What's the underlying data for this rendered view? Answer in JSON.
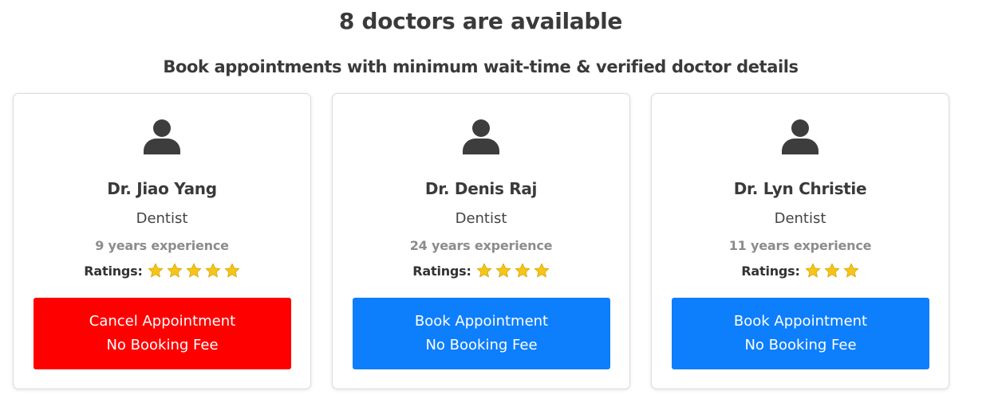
{
  "header": {
    "title": "8 doctors are available",
    "subtitle": "Book appointments with minimum wait-time & verified doctor details"
  },
  "colors": {
    "cancel_button": "#ff0000",
    "book_button": "#0d7efc",
    "star": "#f5c518",
    "icon": "#3d3d3d"
  },
  "doctors": [
    {
      "avatar_icon": "user-icon",
      "name": "Dr. Jiao Yang",
      "specialty": "Dentist",
      "experience": "9 years experience",
      "ratings_label": "Ratings:",
      "rating": 5,
      "button_line1": "Cancel Appointment",
      "button_line2": "No Booking Fee",
      "button_type": "cancel"
    },
    {
      "avatar_icon": "user-icon",
      "name": "Dr. Denis Raj",
      "specialty": "Dentist",
      "experience": "24 years experience",
      "ratings_label": "Ratings:",
      "rating": 4,
      "button_line1": "Book Appointment",
      "button_line2": "No Booking Fee",
      "button_type": "book"
    },
    {
      "avatar_icon": "user-icon",
      "name": "Dr. Lyn Christie",
      "specialty": "Dentist",
      "experience": "11 years experience",
      "ratings_label": "Ratings:",
      "rating": 3,
      "button_line1": "Book Appointment",
      "button_line2": "No Booking Fee",
      "button_type": "book"
    }
  ]
}
